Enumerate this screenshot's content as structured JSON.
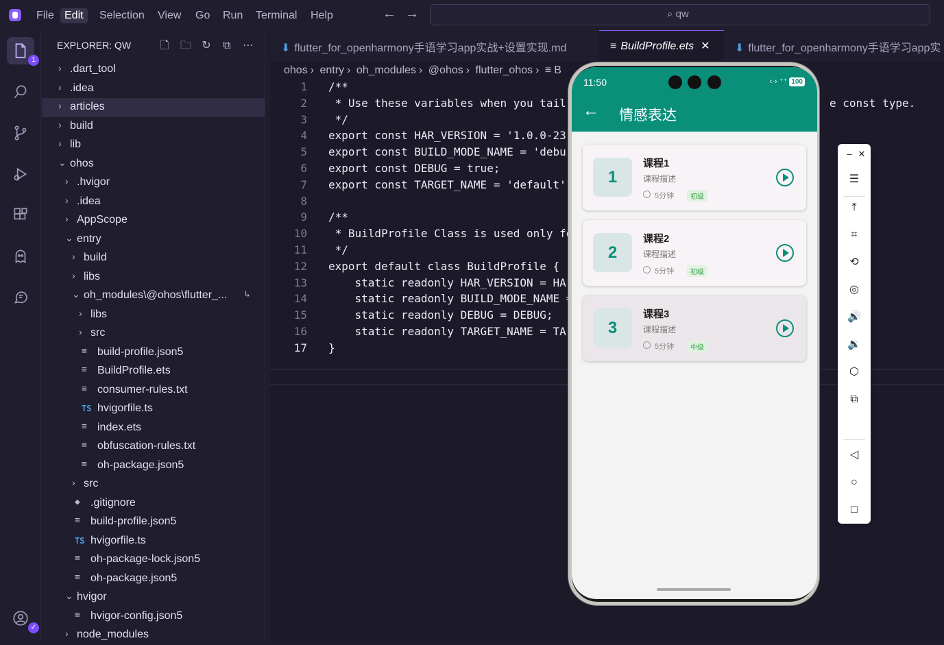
{
  "menu": [
    "File",
    "Edit",
    "Selection",
    "View",
    "Go",
    "Run",
    "Terminal",
    "Help"
  ],
  "active_menu": "Edit",
  "search": {
    "text": "qw"
  },
  "activity_badge": "1",
  "explorer": {
    "title": "EXPLORER: QW",
    "items": [
      {
        "label": ".dart_tool",
        "type": "folder",
        "open": false,
        "depth": 0
      },
      {
        "label": ".idea",
        "type": "folder",
        "open": false,
        "depth": 0
      },
      {
        "label": "articles",
        "type": "folder",
        "open": false,
        "depth": 0,
        "selected": true
      },
      {
        "label": "build",
        "type": "folder",
        "open": false,
        "depth": 0
      },
      {
        "label": "lib",
        "type": "folder",
        "open": false,
        "depth": 0
      },
      {
        "label": "ohos",
        "type": "folder",
        "open": true,
        "depth": 0
      },
      {
        "label": ".hvigor",
        "type": "folder",
        "open": false,
        "depth": 1
      },
      {
        "label": ".idea",
        "type": "folder",
        "open": false,
        "depth": 1
      },
      {
        "label": "AppScope",
        "type": "folder",
        "open": false,
        "depth": 1
      },
      {
        "label": "entry",
        "type": "folder",
        "open": true,
        "depth": 1
      },
      {
        "label": "build",
        "type": "folder",
        "open": false,
        "depth": 2
      },
      {
        "label": "libs",
        "type": "folder",
        "open": false,
        "depth": 2
      },
      {
        "label": "oh_modules\\@ohos\\flutter_...",
        "type": "folder",
        "open": true,
        "depth": 2,
        "link": true
      },
      {
        "label": "libs",
        "type": "folder",
        "open": false,
        "depth": 3
      },
      {
        "label": "src",
        "type": "folder",
        "open": false,
        "depth": 3
      },
      {
        "label": "build-profile.json5",
        "type": "file",
        "depth": 3
      },
      {
        "label": "BuildProfile.ets",
        "type": "file",
        "depth": 3
      },
      {
        "label": "consumer-rules.txt",
        "type": "file",
        "depth": 3
      },
      {
        "label": "hvigorfile.ts",
        "type": "ts",
        "depth": 3
      },
      {
        "label": "index.ets",
        "type": "file",
        "depth": 3
      },
      {
        "label": "obfuscation-rules.txt",
        "type": "file",
        "depth": 3
      },
      {
        "label": "oh-package.json5",
        "type": "file",
        "depth": 3
      },
      {
        "label": "src",
        "type": "folder",
        "open": false,
        "depth": 2
      },
      {
        "label": ".gitignore",
        "type": "git",
        "depth": 2
      },
      {
        "label": "build-profile.json5",
        "type": "file",
        "depth": 2
      },
      {
        "label": "hvigorfile.ts",
        "type": "ts",
        "depth": 2
      },
      {
        "label": "oh-package-lock.json5",
        "type": "file",
        "depth": 2
      },
      {
        "label": "oh-package.json5",
        "type": "file",
        "depth": 2
      },
      {
        "label": "hvigor",
        "type": "folder",
        "open": true,
        "depth": 1
      },
      {
        "label": "hvigor-config.json5",
        "type": "file",
        "depth": 2
      },
      {
        "label": "node_modules",
        "type": "folder",
        "open": false,
        "depth": 1
      }
    ]
  },
  "tabs": [
    {
      "label": "flutter_for_openharmony手语学习app实战+设置实现.md",
      "active": false
    },
    {
      "label": "BuildProfile.ets",
      "active": true
    },
    {
      "label": "flutter_for_openharmony手语学习app实",
      "active": false
    }
  ],
  "breadcrumb": [
    "ohos",
    "entry",
    "oh_modules",
    "@ohos",
    "flutter_ohos"
  ],
  "breadcrumb_tail": "B",
  "code": {
    "lines": [
      {
        "n": "1",
        "t": "/**"
      },
      {
        "n": "2",
        "t": " * Use these variables when you tail"
      },
      {
        "n": "3",
        "t": " */"
      },
      {
        "n": "4",
        "t": "export const HAR_VERSION = '1.0.0-23"
      },
      {
        "n": "5",
        "t": "export const BUILD_MODE_NAME = 'debu"
      },
      {
        "n": "6",
        "t": "export const DEBUG = true;"
      },
      {
        "n": "7",
        "t": "export const TARGET_NAME = 'default'"
      },
      {
        "n": "8",
        "t": ""
      },
      {
        "n": "9",
        "t": "/**"
      },
      {
        "n": "10",
        "t": " * BuildProfile Class is used only fo"
      },
      {
        "n": "11",
        "t": " */"
      },
      {
        "n": "12",
        "t": "export default class BuildProfile {"
      },
      {
        "n": "13",
        "t": "    static readonly HAR_VERSION = HA"
      },
      {
        "n": "14",
        "t": "    static readonly BUILD_MODE_NAME ="
      },
      {
        "n": "15",
        "t": "    static readonly DEBUG = DEBUG;"
      },
      {
        "n": "16",
        "t": "    static readonly TARGET_NAME = TA"
      },
      {
        "n": "17",
        "t": "}"
      }
    ],
    "right_fragment": "e const type."
  },
  "phone": {
    "time": "11:50",
    "battery": "100",
    "title": "情感表达",
    "courses": [
      {
        "num": "1",
        "title": "课程1",
        "desc": "课程描述",
        "duration": "5分钟",
        "level": "初级"
      },
      {
        "num": "2",
        "title": "课程2",
        "desc": "课程描述",
        "duration": "5分钟",
        "level": "初级"
      },
      {
        "num": "3",
        "title": "课程3",
        "desc": "课程描述",
        "duration": "5分钟",
        "level": "中级"
      }
    ]
  }
}
